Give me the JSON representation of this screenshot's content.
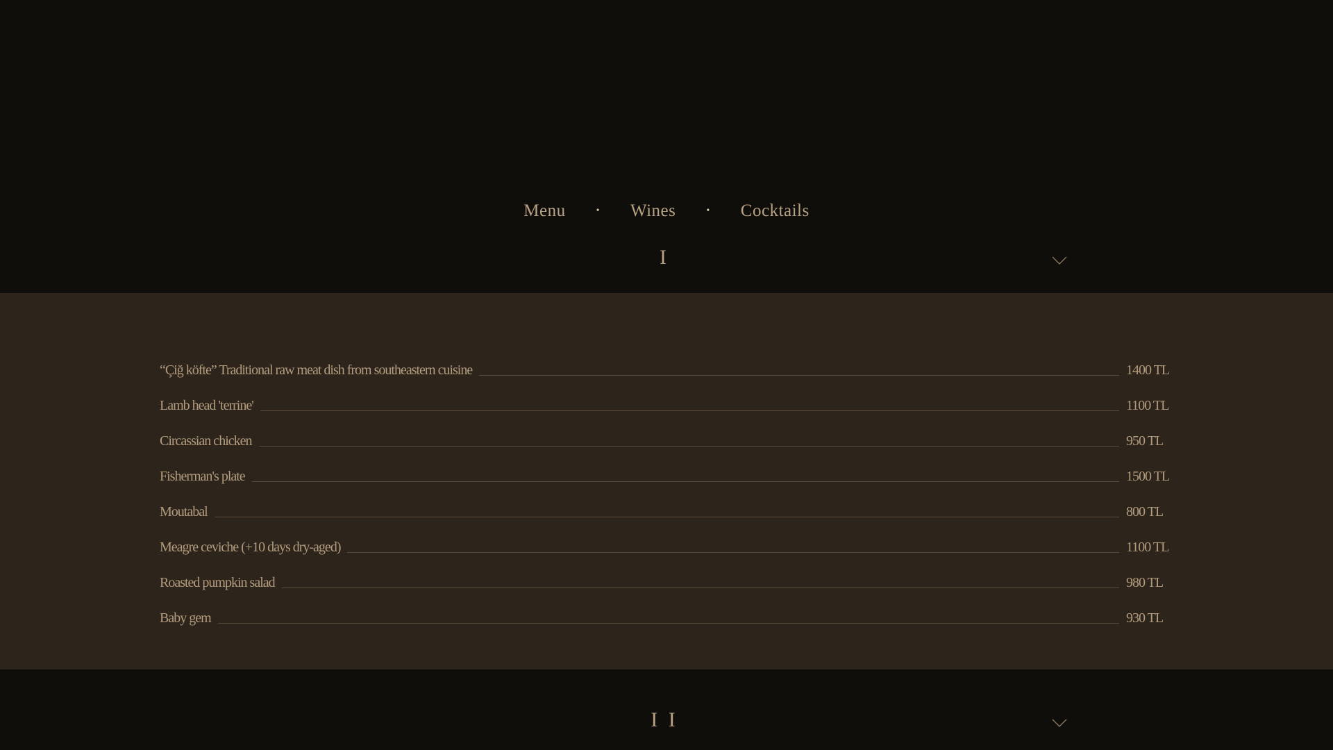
{
  "nav": {
    "items": [
      {
        "label": "Menu"
      },
      {
        "label": "Wines"
      },
      {
        "label": "Cocktails"
      }
    ],
    "separator": "•"
  },
  "sections": [
    {
      "numeral": "I",
      "expanded": true,
      "items": [
        {
          "name": "“Çiğ köfte” Traditional raw meat dish from southeastern cuisine",
          "price": "1400 TL"
        },
        {
          "name": "Lamb head 'terrine'",
          "price": "1100 TL"
        },
        {
          "name": "Circassian chicken",
          "price": "950 TL"
        },
        {
          "name": "Fisherman's plate",
          "price": "1500 TL"
        },
        {
          "name": "Moutabal",
          "price": "800 TL"
        },
        {
          "name": "Meagre ceviche (+10 days dry-aged)",
          "price": "1100 TL"
        },
        {
          "name": "Roasted pumpkin salad",
          "price": "980 TL"
        },
        {
          "name": "Baby gem",
          "price": "930 TL"
        }
      ]
    },
    {
      "numeral": "I I",
      "expanded": false
    }
  ],
  "icons": {
    "section_toggle": "chevron-down-icon"
  },
  "colors": {
    "background": "#0f0e0b",
    "panel": "#2d251c",
    "text": "#b39c7e",
    "accent": "#b9a284"
  }
}
